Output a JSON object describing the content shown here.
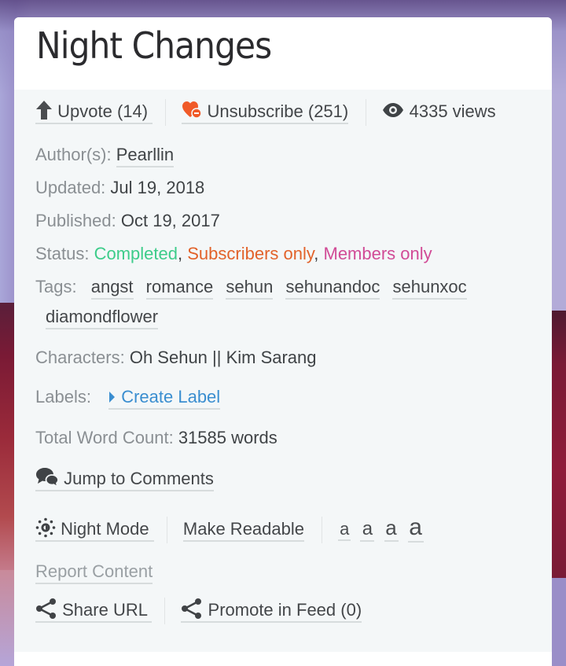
{
  "story": {
    "title": "Night Changes"
  },
  "actions": {
    "upvote": {
      "label": "Upvote",
      "count": "(14)",
      "icon": "arrow-up-icon"
    },
    "subscribe": {
      "label": "Unsubscribe",
      "count": "(251)",
      "icon": "heart-minus-icon",
      "icon_color": "#f05a28"
    },
    "views": {
      "label": "4335 views",
      "icon": "eye-icon"
    }
  },
  "meta": {
    "author_label": "Author(s):",
    "author": "Pearllin",
    "updated_label": "Updated:",
    "updated": "Jul 19, 2018",
    "published_label": "Published:",
    "published": "Oct 19, 2017",
    "status_label": "Status:",
    "status": [
      {
        "text": "Completed",
        "color": "#3dcc8a"
      },
      {
        "text": "Subscribers only",
        "color": "#e2622a"
      },
      {
        "text": "Members only",
        "color": "#d14b96"
      }
    ],
    "status_sep": ",",
    "tags_label": "Tags:",
    "tags": [
      "angst",
      "romance",
      "sehun",
      "sehunandoc",
      "sehunxoc",
      "diamondflower"
    ],
    "characters_label": "Characters:",
    "characters": "Oh Sehun || Kim Sarang",
    "labels_label": "Labels:",
    "create_label": "Create Label",
    "word_count_label": "Total Word Count:",
    "word_count": "31585 words"
  },
  "tools": {
    "jump_comments": "Jump to Comments",
    "night_mode": "Night Mode",
    "make_readable": "Make Readable",
    "font_sizes": [
      "a",
      "a",
      "a",
      "a"
    ],
    "report": "Report Content",
    "share_url": "Share URL",
    "promote": "Promote in Feed (0)"
  }
}
